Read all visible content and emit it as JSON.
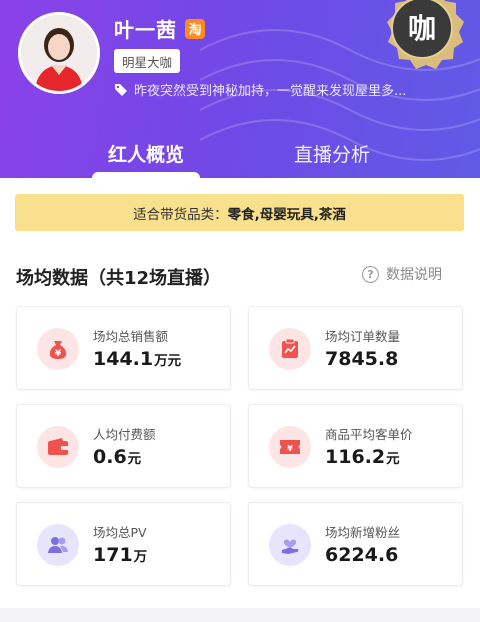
{
  "profile": {
    "name": "叶一茜",
    "platform_badge": "淘",
    "level_tag": "明星大咖",
    "bio": "昨夜突然受到神秘加持，一觉醒来发现屋里多...",
    "medal_text": "咖"
  },
  "tabs": [
    {
      "label": "红人概览",
      "active": true
    },
    {
      "label": "直播分析",
      "active": false
    }
  ],
  "category": {
    "prefix": "适合带货品类：",
    "value": "零食,母婴玩具,茶酒"
  },
  "section": {
    "title": "场均数据（共12场直播）",
    "help_label": "数据说明",
    "help_icon": "?"
  },
  "stats": [
    {
      "label": "场均总销售额",
      "value": "144.1",
      "unit": "万元",
      "icon": "money-bag-icon"
    },
    {
      "label": "场均订单数量",
      "value": "7845.8",
      "unit": "",
      "icon": "order-chart-icon"
    },
    {
      "label": "人均付费额",
      "value": "0.6",
      "unit": "元",
      "icon": "wallet-icon"
    },
    {
      "label": "商品平均客单价",
      "value": "116.2",
      "unit": "元",
      "icon": "ticket-icon"
    },
    {
      "label": "场均总PV",
      "value": "171",
      "unit": "万",
      "icon": "users-icon"
    },
    {
      "label": "场均新增粉丝",
      "value": "6224.6",
      "unit": "",
      "icon": "heart-hand-icon"
    }
  ],
  "colors": {
    "header_start": "#8a42e8",
    "header_end": "#5f5be6",
    "banner": "#f8e08c",
    "icon_red": "#ef5350",
    "icon_purple": "#7d6fe0",
    "medal_gold": "#c9a45c"
  }
}
